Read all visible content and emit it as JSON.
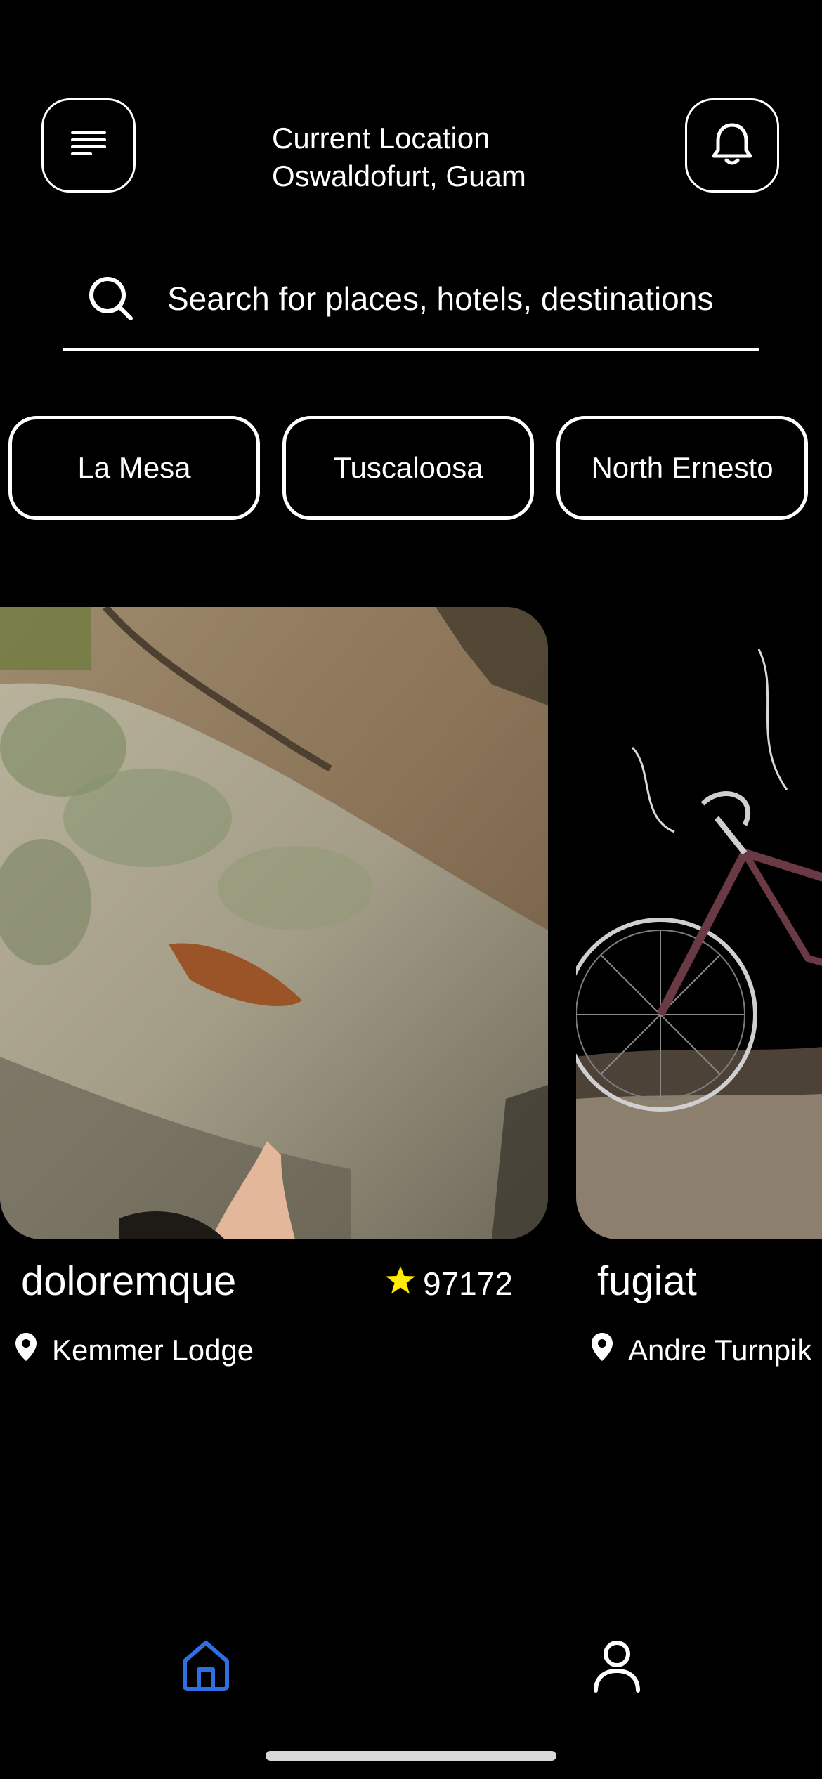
{
  "header": {
    "location_label": "Current Location",
    "location_value": "Oswaldofurt, Guam",
    "menu_icon": "menu-lines-icon",
    "notification_icon": "bell-icon"
  },
  "search": {
    "placeholder": "Search for places, hotels, destinations",
    "icon": "search-icon"
  },
  "chips": [
    {
      "label": "La Mesa"
    },
    {
      "label": "Tuscaloosa"
    },
    {
      "label": "North Ernesto"
    }
  ],
  "cards": [
    {
      "title": "doloremque",
      "rating": "97172",
      "location": "Kemmer Lodge",
      "image_subject": "rock-climber-photo"
    },
    {
      "title": "fugiat",
      "rating": "",
      "location": "Andre Turnpik",
      "image_subject": "bicycle-photo"
    }
  ],
  "nav": {
    "items": [
      {
        "icon": "home-icon",
        "active": true
      },
      {
        "icon": "profile-icon",
        "active": false
      }
    ],
    "active_color": "#2f6fe4",
    "inactive_color": "#ffffff"
  },
  "colors": {
    "background": "#000000",
    "foreground": "#ffffff",
    "star": "#ffeb00"
  }
}
